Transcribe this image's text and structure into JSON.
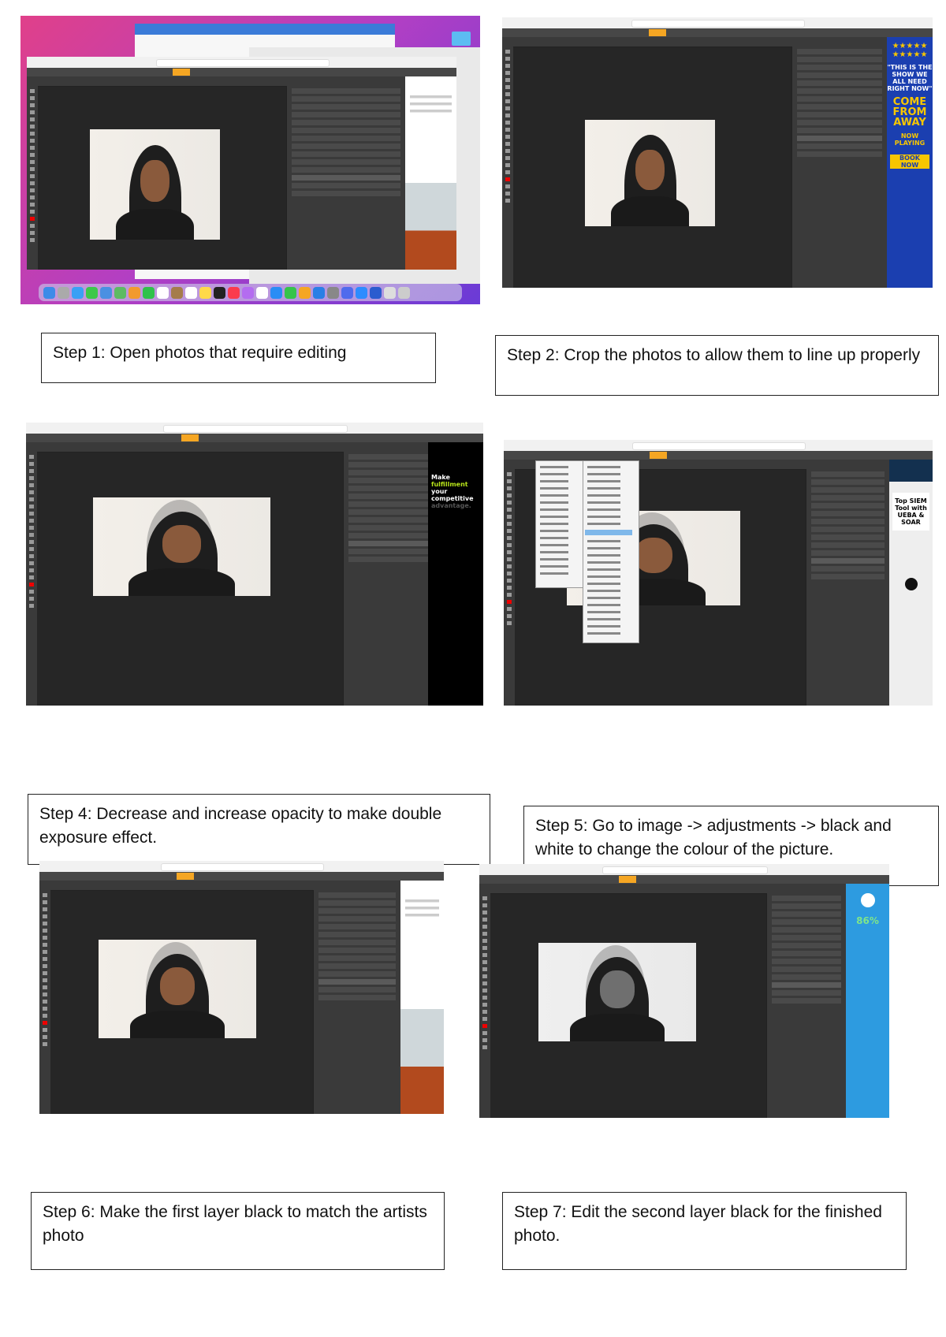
{
  "steps": {
    "step1": "Step 1: Open photos that require editing",
    "step2": "Step 2: Crop the photos to allow them to line up properly",
    "step4": "Step 4: Decrease and increase opacity to make double exposure effect.",
    "step5": "Step 5: Go to image -> adjustments -> black and white to change the colour of the picture.",
    "step6": "Step 6: Make the first layer black to match the artists photo",
    "step7": "Step 7: Edit the second layer black for the finished photo."
  },
  "ads": {
    "shot2": {
      "quote": "\"THIS IS THE SHOW WE ALL NEED RIGHT NOW\"",
      "title": "COME FROM AWAY",
      "sub": "NOW PLAYING",
      "cta": "BOOK NOW"
    },
    "shot3": {
      "line1": "Make",
      "line2": "fulfillment",
      "line3": "your competitive",
      "line4": "advantage."
    },
    "shot4": {
      "title": "Top SIEM Tool with UEBA & SOAR"
    },
    "shot7": {
      "value": "86%"
    }
  },
  "colors": {
    "ps_accent": "#f5a623",
    "canvas": "#262626",
    "panel": "#3a3a3a"
  }
}
